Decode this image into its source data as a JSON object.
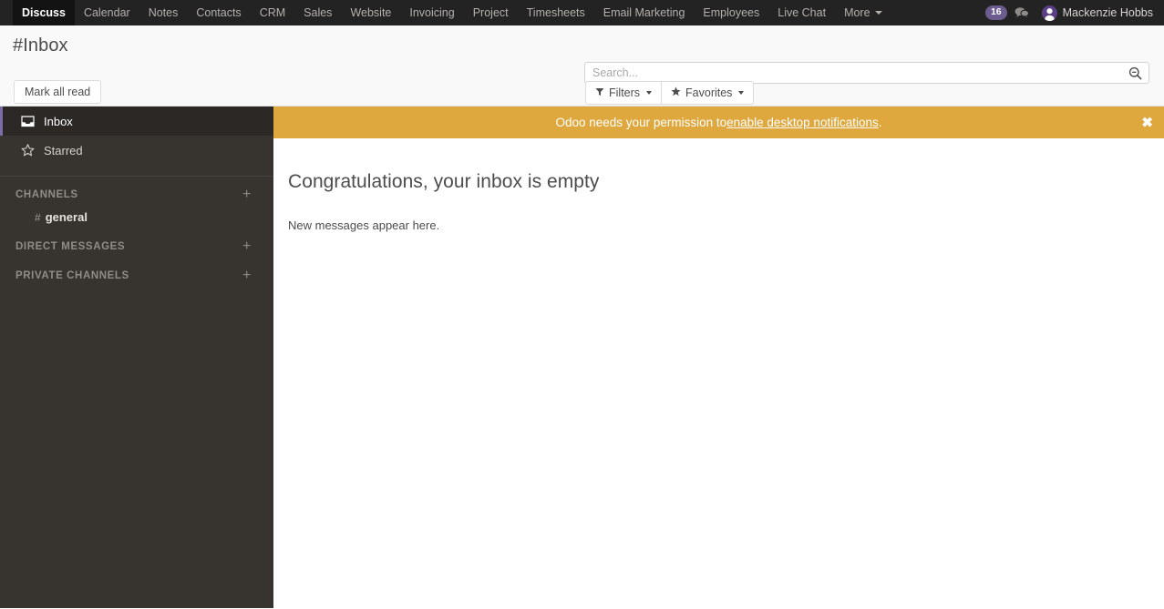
{
  "navbar": {
    "apps": [
      {
        "label": "Discuss",
        "active": true
      },
      {
        "label": "Calendar",
        "active": false
      },
      {
        "label": "Notes",
        "active": false
      },
      {
        "label": "Contacts",
        "active": false
      },
      {
        "label": "CRM",
        "active": false
      },
      {
        "label": "Sales",
        "active": false
      },
      {
        "label": "Website",
        "active": false
      },
      {
        "label": "Invoicing",
        "active": false
      },
      {
        "label": "Project",
        "active": false
      },
      {
        "label": "Timesheets",
        "active": false
      },
      {
        "label": "Email Marketing",
        "active": false
      },
      {
        "label": "Employees",
        "active": false
      },
      {
        "label": "Live Chat",
        "active": false
      }
    ],
    "more_label": "More",
    "message_count": "16",
    "chat_icon": "chat-bubble-icon",
    "avatar_icon": "user-avatar-icon",
    "user_name": "Mackenzie Hobbs",
    "bg_color": "#232323",
    "active_bg_color": "#131313",
    "badge_color": "#6c5b8e"
  },
  "header": {
    "title": "#Inbox",
    "mark_all_read_label": "Mark all read",
    "search": {
      "placeholder": "Search...",
      "value": "",
      "icon": "search-icon"
    },
    "filters_label": "Filters",
    "filters_icon": "funnel-icon",
    "favorites_label": "Favorites",
    "favorites_icon": "star-icon"
  },
  "sidebar": {
    "bg_color": "#37332f",
    "active_accent_color": "#7c6ca8",
    "items": [
      {
        "label": "Inbox",
        "icon": "inbox-icon",
        "active": true
      },
      {
        "label": "Starred",
        "icon": "star-outline-icon",
        "active": false
      }
    ],
    "sections": [
      {
        "label": "CHANNELS",
        "add_label": "+",
        "channels": [
          {
            "label": "general",
            "prefix": "#"
          }
        ]
      },
      {
        "label": "DIRECT MESSAGES",
        "add_label": "+",
        "channels": []
      },
      {
        "label": "PRIVATE CHANNELS",
        "add_label": "+",
        "channels": []
      }
    ]
  },
  "main": {
    "notification": {
      "text_before": "Odoo needs your permission to ",
      "link_text": "enable desktop notifications",
      "text_after": ".",
      "close_label": "✖",
      "bg_color": "#dfa83f"
    },
    "empty_state": {
      "title": "Congratulations, your inbox is empty",
      "subtitle": "New messages appear here."
    }
  }
}
